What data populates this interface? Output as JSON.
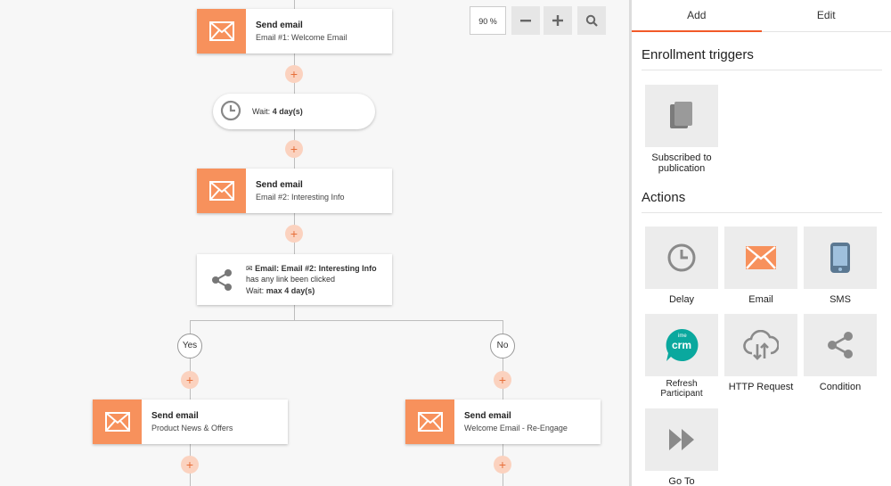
{
  "canvas": {
    "zoom": "90 %",
    "nodes": {
      "email1": {
        "title": "Send email",
        "subtitle": "Email #1: Welcome Email"
      },
      "wait1": {
        "label": "Wait:",
        "value": "4 day(s)"
      },
      "email2": {
        "title": "Send email",
        "subtitle": "Email #2: Interesting Info"
      },
      "condition": {
        "line1_label": "Email:",
        "line1_value": "Email #2: Interesting Info",
        "line2": "has any link been clicked",
        "line3_label": "Wait:",
        "line3_value": "max 4 day(s)"
      },
      "email_yes": {
        "title": "Send email",
        "subtitle": "Product News & Offers"
      },
      "email_no": {
        "title": "Send email",
        "subtitle": "Welcome Email - Re-Engage"
      }
    },
    "branches": {
      "yes": "Yes",
      "no": "No"
    },
    "plus_label": "+"
  },
  "panel": {
    "tabs": [
      "Add",
      "Edit"
    ],
    "enrollment_title": "Enrollment triggers",
    "triggers": [
      {
        "label": "Subscribed to publication"
      }
    ],
    "actions_title": "Actions",
    "actions": [
      {
        "label": "Delay"
      },
      {
        "label": "Email"
      },
      {
        "label": "SMS"
      },
      {
        "label": "Refresh Participant",
        "logo_text": "crm",
        "logo_small": "ime"
      },
      {
        "label": "HTTP Request"
      },
      {
        "label": "Condition"
      },
      {
        "label": "Go To"
      }
    ]
  },
  "colors": {
    "accent": "#f7915c",
    "tab_active": "#f25a29",
    "plus_bg": "#fbd2bf",
    "crm_teal": "#0aa89e"
  }
}
